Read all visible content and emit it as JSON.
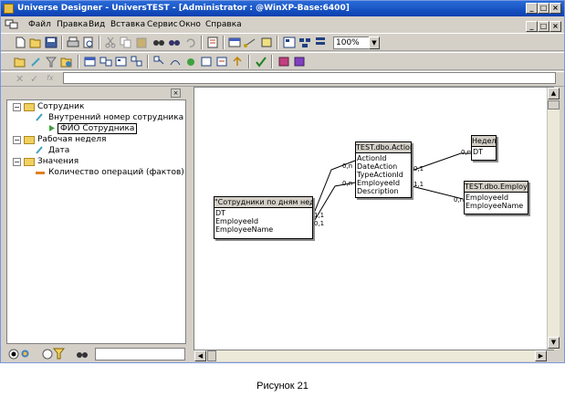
{
  "window": {
    "title": "Universe Designer - UniversTEST - [Administrator : @WinXP-Base:6400]"
  },
  "menu": [
    "Файл",
    "Правка",
    "Вид",
    "Вставка",
    "Сервис",
    "Окно",
    "Справка"
  ],
  "toolbar": {
    "zoom": "100%"
  },
  "tree": {
    "items": [
      {
        "label": "Сотрудник"
      },
      {
        "label": "Внутренний номер сотрудника"
      },
      {
        "label": "ФИО Сотрудника"
      },
      {
        "label": "Рабочая неделя"
      },
      {
        "label": "Дата"
      },
      {
        "label": "Значения"
      },
      {
        "label": "Количество операций (фактов)"
      }
    ]
  },
  "schema": {
    "tables": [
      {
        "name": "\"Сотрудники по дням недели\"",
        "columns": [
          "DT",
          "EmployeeId",
          "EmployeeName"
        ]
      },
      {
        "name": "TEST.dbo.Action",
        "columns": [
          "ActionId",
          "DateAction",
          "TypeActionId",
          "EmployeeId",
          "Description"
        ]
      },
      {
        "name": "Неделя",
        "columns": [
          "DT"
        ]
      },
      {
        "name": "TEST.dbo.Employee",
        "columns": [
          "EmployeeId",
          "EmployeeName"
        ]
      }
    ],
    "cardinalities": [
      "0,n",
      "0,n",
      "1,1",
      "0,1",
      "0,1",
      "0,n",
      "0,n",
      "1,1"
    ]
  },
  "caption": "Рисунок 21"
}
